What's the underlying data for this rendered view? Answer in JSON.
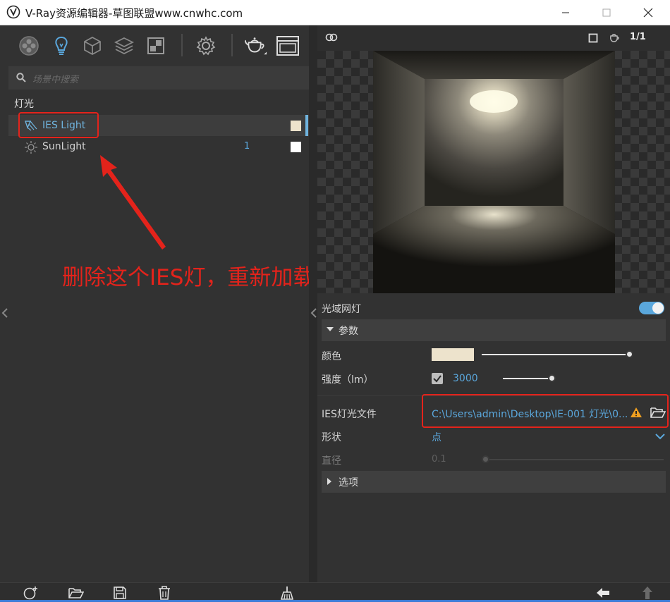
{
  "window": {
    "title": "V-Ray资源编辑器-草图联盟www.cnwhc.com"
  },
  "toolbar": {
    "icons": [
      "materials-icon",
      "lights-icon",
      "geometry-icon",
      "layers-icon",
      "render-elements-icon",
      "settings-icon",
      "render-icon",
      "frame-buffer-icon"
    ]
  },
  "search": {
    "placeholder": "场景中搜索"
  },
  "lights": {
    "category": "灯光",
    "items": [
      {
        "name": "IES Light",
        "count": "",
        "swatch": "#ede3cc",
        "selected": true
      },
      {
        "name": "SunLight",
        "count": "1",
        "swatch": "#ffffff",
        "selected": false
      }
    ]
  },
  "annotation": {
    "text": "删除这个IES灯，重新加载一个IES文件",
    "color": "#e4231b"
  },
  "preview": {
    "ratio": "1/1"
  },
  "properties": {
    "light_type": "光域网灯",
    "enabled": true,
    "params_section": "参数",
    "color_label": "颜色",
    "color_value": "#ede3cc",
    "intensity_label": "强度（lm）",
    "intensity_value": "3000",
    "intensity_checked": true,
    "ies_file_label": "IES灯光文件",
    "ies_file_path": "C:\\Users\\admin\\Desktop\\IE-001 灯光\\0...",
    "shape_label": "形状",
    "shape_value": "点",
    "diameter_label": "直径",
    "diameter_value": "0.1",
    "options_section": "选项"
  },
  "colors": {
    "accent": "#5aa7dc",
    "highlight": "#e4231b",
    "warning": "#f0a020"
  }
}
